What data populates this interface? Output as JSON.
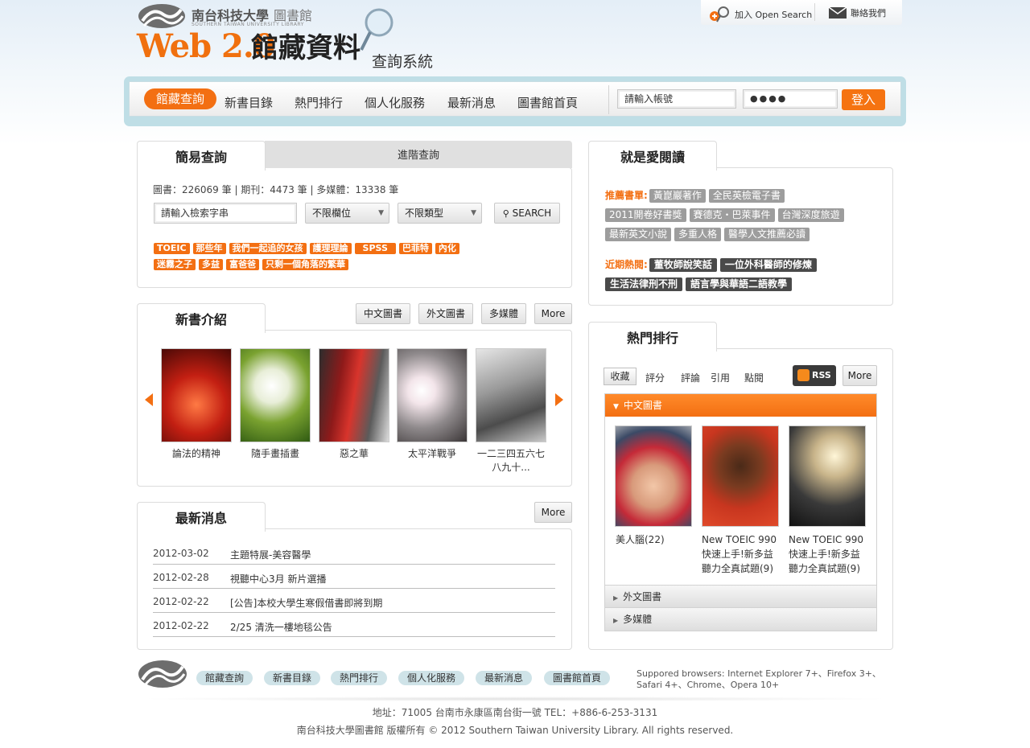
{
  "header": {
    "library_name": "南台科技大學",
    "library_suffix": "圖書館",
    "library_en": "SOUTHERN TAIWAN UNIVERSITY LIBRARY",
    "logo_web": "Web 2.0",
    "logo_catalog": "館藏資料",
    "logo_system": "查詢系統",
    "top_links": {
      "open_search": "加入 Open Search",
      "contact": "聯絡我們"
    }
  },
  "nav": {
    "items": [
      "館藏查詢",
      "新書目錄",
      "熱門排行",
      "個人化服務",
      "最新消息",
      "圖書館首頁"
    ],
    "login": {
      "account_placeholder": "請輸入帳號",
      "password_value": "●●●●",
      "login_label": "登入"
    }
  },
  "search": {
    "tab_simple": "簡易查詢",
    "tab_advanced": "進階查詢",
    "stats": "圖書：226069 筆 | 期刊：4473 筆 | 多媒體：13338 筆",
    "query_placeholder": "請輸入檢索字串",
    "field_select": "不限欄位",
    "type_select": "不限類型",
    "search_label": "SEARCH",
    "tags": [
      "TOEIC",
      "那些年",
      "我們一起追的女孩",
      "護理理論",
      "SPSS",
      "巴菲特",
      "內化",
      "迷霧之子",
      "多益",
      "富爸爸",
      "只剩一個角落的繁華"
    ]
  },
  "new_books": {
    "title": "新書介紹",
    "filters": [
      "中文圖書",
      "外文圖書",
      "多媒體",
      "More"
    ],
    "books": [
      {
        "title": "論法的精神"
      },
      {
        "title": "隨手畫插畫"
      },
      {
        "title": "惡之華"
      },
      {
        "title": "太平洋戰爭"
      },
      {
        "title": "一二三四五六七八九十..."
      }
    ]
  },
  "news": {
    "title": "最新消息",
    "more": "More",
    "rows": [
      {
        "date": "2012-03-02",
        "text": "主題特展-美容醫學"
      },
      {
        "date": "2012-02-28",
        "text": "視聽中心3月 新片選播"
      },
      {
        "date": "2012-02-22",
        "text": "[公告]本校大學生寒假借書即將到期"
      },
      {
        "date": "2012-02-22",
        "text": "2/25 清洗一樓地毯公告"
      }
    ]
  },
  "reading": {
    "title": "就是愛閱讀",
    "recommend_label": "推薦書單:",
    "recommend": [
      "黃崑巖著作",
      "全民英檢電子書",
      "2011開卷好書獎",
      "賽德克・巴萊事件",
      "台灣深度旅遊",
      "最新英文小說",
      "多重人格",
      "醫學人文推薦必讀"
    ],
    "hot_label": "近期熱閱:",
    "hot": [
      "董牧師說笑話",
      "一位外科醫師的修煉",
      "生活法律刑不刑",
      "語言學與華語二語教學"
    ]
  },
  "ranking": {
    "title": "熱門排行",
    "tabs": [
      "收藏",
      "評分",
      "評論",
      "引用",
      "點閱"
    ],
    "rss": "RSS",
    "more": "More",
    "sections": [
      "中文圖書",
      "外文圖書",
      "多媒體"
    ],
    "books": [
      {
        "title": "美人腦(22)"
      },
      {
        "title": "New TOEIC 990快速上手!新多益聽力全真試題(9)"
      },
      {
        "title": "New TOEIC 990快速上手!新多益聽力全真試題(9)"
      }
    ]
  },
  "footer": {
    "nav": [
      "館藏查詢",
      "新書目錄",
      "熱門排行",
      "個人化服務",
      "最新消息",
      "圖書館首頁"
    ],
    "browsers": "Suppored browsers: Internet Explorer 7+、Firefox 3+、Safari 4+、Chrome、Opera 10+",
    "address": "地址：71005 台南市永康區南台街一號 TEL：+886-6-253-3131",
    "copyright": "南台科技大學圖書館 版權所有 © 2012 Southern Taiwan University  Library. All rights reserved."
  },
  "colors": {
    "accent": "#f36f12",
    "nav_frame": "#bfdee6",
    "tag_gray": "#9d9d9d",
    "tag_dark": "#4a4a4a"
  }
}
